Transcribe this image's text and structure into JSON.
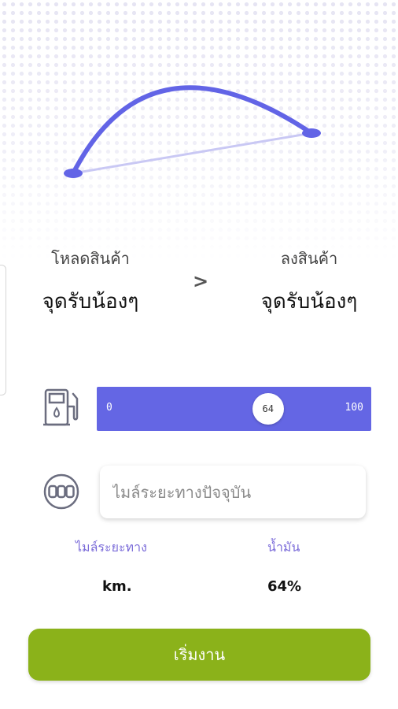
{
  "colors": {
    "accent": "#6466e4",
    "route": "#6264e6",
    "label": "#7b6cd9",
    "button": "#8bb21a"
  },
  "route": {
    "load_caption": "โหลดสินค้า",
    "load_name": "จุดรับน้องๆ",
    "arrow": ">",
    "unload_caption": "ลงสินค้า",
    "unload_name": "จุดรับน้องๆ"
  },
  "fuel_slider": {
    "icon": "fuel-pump-icon",
    "min": "0",
    "max": "100",
    "value": 64,
    "value_label": "64"
  },
  "odometer": {
    "icon": "odometer-icon",
    "placeholder": "ไมล์ระยะทางปัจจุบัน",
    "value": ""
  },
  "stats": {
    "distance_label": "ไมล์ระยะทาง",
    "distance_value": "km.",
    "fuel_label": "น้ำมัน",
    "fuel_value": "64%"
  },
  "start_button": {
    "label": "เริ่มงาน"
  }
}
